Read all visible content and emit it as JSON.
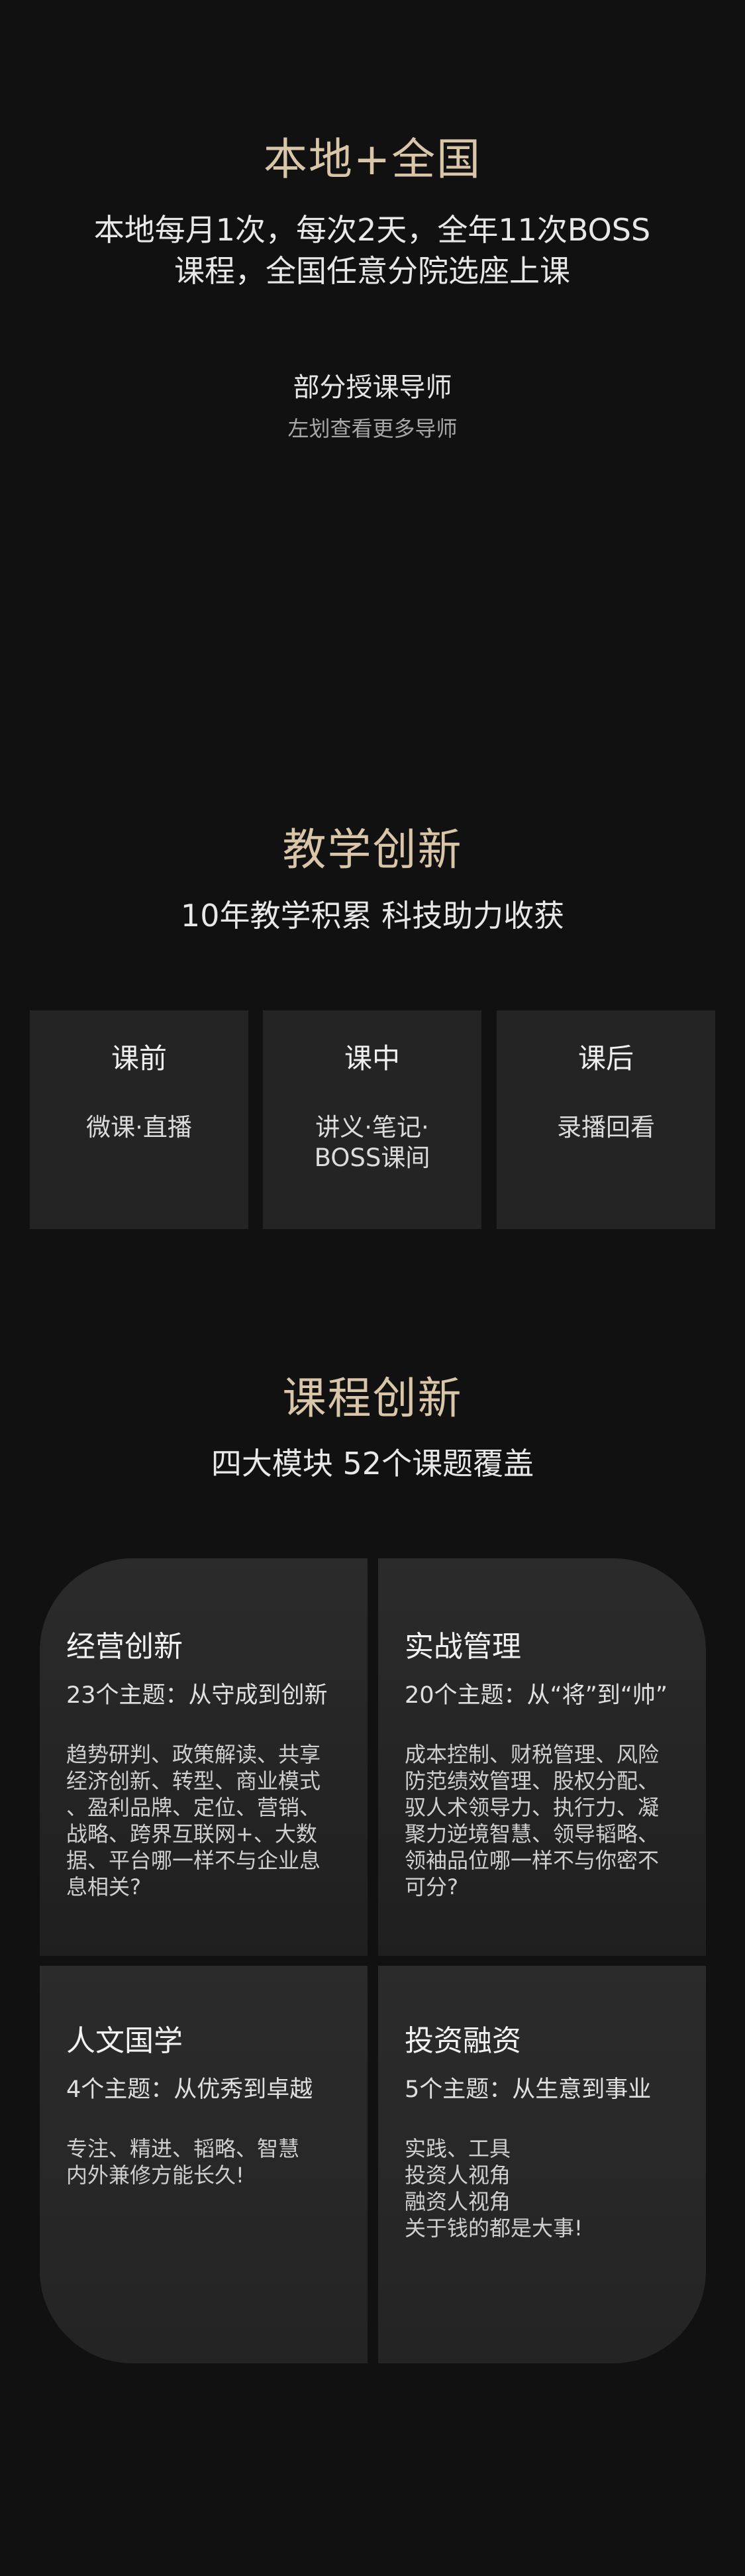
{
  "local_national": {
    "title": "本地+全国",
    "subtitle_line1": "本地每月1次，每次2天，全年11次BOSS",
    "subtitle_line2": "课程，全国任意分院选座上课",
    "teachers_label": "部分授课导师",
    "swipe_hint": "左划查看更多导师"
  },
  "teaching_innovation": {
    "title": "教学创新",
    "subtitle": "10年教学积累 科技助力收获",
    "cards": [
      {
        "title": "课前",
        "desc_line1": "微课·直播",
        "desc_line2": ""
      },
      {
        "title": "课中",
        "desc_line1": "讲义·笔记·",
        "desc_line2": "BOSS课间"
      },
      {
        "title": "课后",
        "desc_line1": "录播回看",
        "desc_line2": ""
      }
    ]
  },
  "course_innovation": {
    "title": "课程创新",
    "subtitle": "四大模块 52个课题覆盖",
    "modules": [
      {
        "title": "经营创新",
        "topics": "23个主题：从守成到创新",
        "desc": [
          "趋势研判、政策解读、共享",
          "经济创新、转型、商业模式",
          "、盈利品牌、定位、营销、",
          "战略、跨界互联网+、大数",
          "据、平台哪一样不与企业息",
          "息相关?"
        ]
      },
      {
        "title": "实战管理",
        "topics": "20个主题：从“将”到“帅”",
        "desc": [
          "成本控制、财税管理、风险",
          "防范绩效管理、股权分配、",
          "驭人术领导力、执行力、凝",
          "聚力逆境智慧、领导韬略、",
          "领袖品位哪一样不与你密不",
          "可分?"
        ]
      },
      {
        "title": "人文国学",
        "topics": "4个主题：从优秀到卓越",
        "desc": [
          "专注、精进、韬略、智慧",
          "内外兼修方能长久!"
        ]
      },
      {
        "title": "投资融资",
        "topics": "5个主题：从生意到事业",
        "desc": [
          "实践、工具",
          "投资人视角",
          "融资人视角",
          "关于钱的都是大事!"
        ]
      }
    ]
  }
}
